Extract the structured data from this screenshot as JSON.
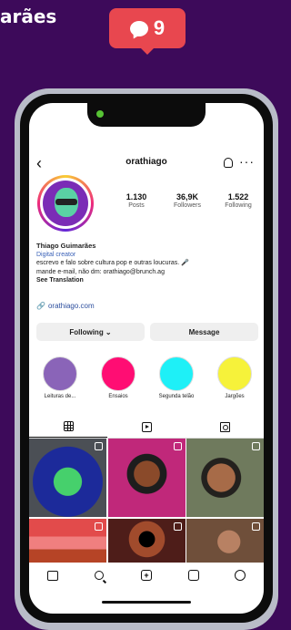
{
  "top_fragment": "arães",
  "notification": {
    "icon": "comment-bubble-icon",
    "count": "9",
    "color": "#e8474f"
  },
  "header": {
    "username": "orathiago",
    "back_icon": "chevron-left-icon",
    "notif_icon": "bell-icon",
    "more_icon": "more-icon"
  },
  "stats": [
    {
      "value": "1.130",
      "label": "Posts"
    },
    {
      "value": "36,9K",
      "label": "Followers"
    },
    {
      "value": "1.522",
      "label": "Following"
    }
  ],
  "bio": {
    "name": "Thiago Guimarães",
    "category": "Digital creator",
    "line1": "escrevo e falo sobre cultura pop e outras loucuras. 🎤",
    "line2": "mande e-mail, não dm: orathiago@brunch.ag",
    "see_translation": "See Translation",
    "link": "orathiago.com"
  },
  "buttons": {
    "following": "Following ⌄",
    "message": "Message"
  },
  "highlights": [
    {
      "label": "Leituras de...",
      "color": "#8a64b8"
    },
    {
      "label": "Ensaios",
      "color": "#ff0d73"
    },
    {
      "label": "Segunda telão",
      "color": "#1ef0f7"
    },
    {
      "label": "Jargões",
      "color": "#f6f23a"
    }
  ],
  "profile_tabs": [
    "grid-icon",
    "reels-icon",
    "tagged-icon"
  ],
  "nav_icons": [
    "home-icon",
    "search-icon",
    "add-icon",
    "reels-icon",
    "profile-icon"
  ]
}
